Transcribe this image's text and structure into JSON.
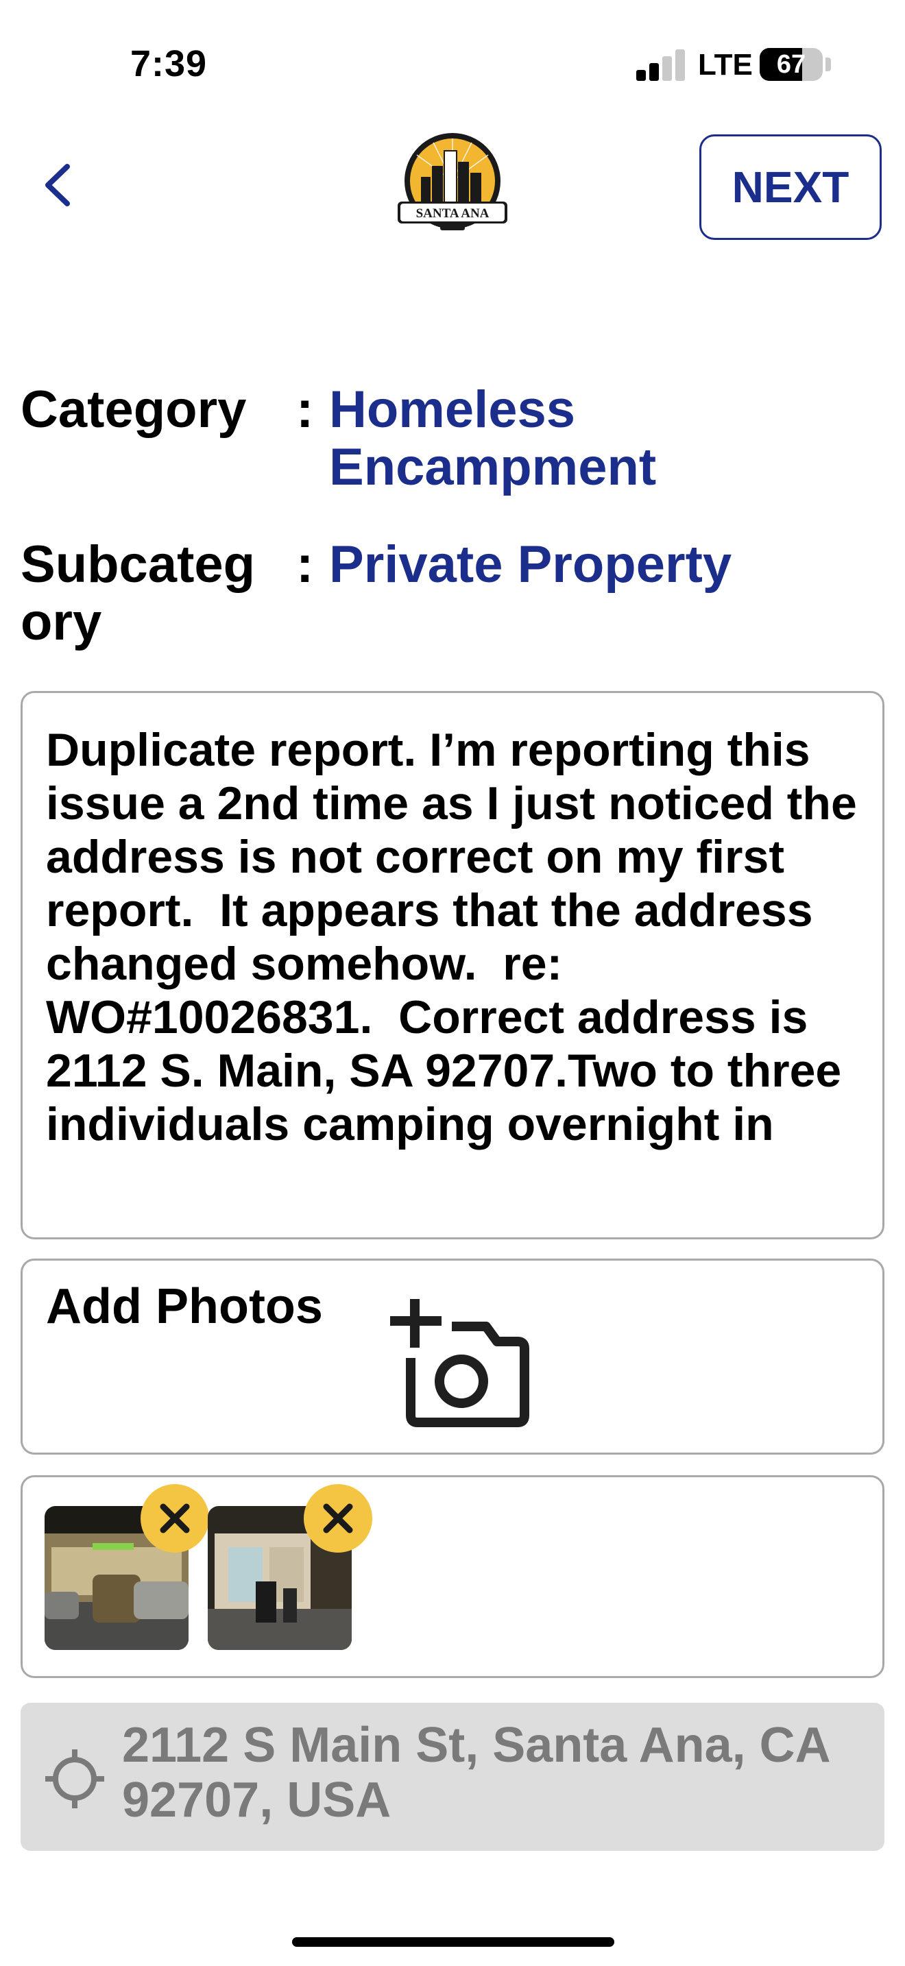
{
  "status_bar": {
    "time": "7:39",
    "network": "LTE",
    "battery": "67"
  },
  "header": {
    "next_label": "NEXT",
    "logo_text": "SANTA ANA"
  },
  "fields": {
    "category_label": "Category",
    "category_value": "Homeless Encampment",
    "subcategory_label": "Subcateg ory",
    "subcategory_value": "Private Property",
    "colon": ":"
  },
  "description": "Duplicate report. I’m reporting this issue a 2nd time as I just noticed the address is not correct on my first report.  It appears that the address changed somehow.  re: WO#10026831.  Correct address is 2112 S. Main, SA 92707.Two to three individuals camping overnight in",
  "photos": {
    "add_label": "Add Photos",
    "count": 2
  },
  "location": {
    "address": "2112 S Main St, Santa Ana, CA 92707, USA"
  },
  "colors": {
    "accent": "#1b2e8c",
    "remove_badge": "#f4c542",
    "address_bg": "#dddddd"
  },
  "icons": [
    "chevron-left-icon",
    "add-photo-icon",
    "close-icon",
    "locate-icon"
  ]
}
